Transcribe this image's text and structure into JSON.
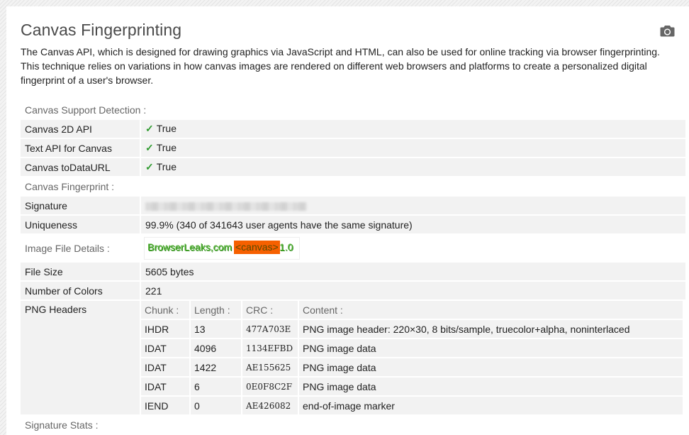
{
  "header": {
    "title": "Canvas Fingerprinting",
    "description": "The Canvas API, which is designed for drawing graphics via JavaScript and HTML, can also be used for online tracking via browser fingerprinting. This technique relies on variations in how canvas images are rendered on different web browsers and platforms to create a personalized digital fingerprint of a user's browser.",
    "camera_icon": "camera-icon"
  },
  "support": {
    "section_label": "Canvas Support Detection :",
    "rows": [
      {
        "label": "Canvas 2D API",
        "value": "True"
      },
      {
        "label": "Text API for Canvas",
        "value": "True"
      },
      {
        "label": "Canvas toDataURL",
        "value": "True"
      }
    ],
    "check_glyph": "✓"
  },
  "fingerprint": {
    "section_label": "Canvas Fingerprint :",
    "signature_label": "Signature",
    "uniqueness_label": "Uniqueness",
    "uniqueness_value": "99.9% (340 of 341643 user agents have the same signature)"
  },
  "image": {
    "section_label": "Image File Details :",
    "canvas_text_1": "BrowserLeaks,com",
    "canvas_badge": "<canvas>",
    "canvas_text_2": "1.0",
    "file_size_label": "File Size",
    "file_size_value": "5605 bytes",
    "colors_label": "Number of Colors",
    "colors_value": "221",
    "png_label": "PNG Headers",
    "png_columns": [
      "Chunk :",
      "Length :",
      "CRC :",
      "Content :"
    ],
    "png_rows": [
      {
        "chunk": "IHDR",
        "length": "13",
        "crc": "477A703E",
        "content": "PNG image header: 220×30, 8 bits/sample, truecolor+alpha, noninterlaced"
      },
      {
        "chunk": "IDAT",
        "length": "4096",
        "crc": "1134EFBD",
        "content": "PNG image data"
      },
      {
        "chunk": "IDAT",
        "length": "1422",
        "crc": "AE155625",
        "content": "PNG image data"
      },
      {
        "chunk": "IDAT",
        "length": "6",
        "crc": "0E0F8C2F",
        "content": "PNG image data"
      },
      {
        "chunk": "IEND",
        "length": "0",
        "crc": "AE426082",
        "content": "end-of-image marker"
      }
    ]
  },
  "stats": {
    "section_label": "Signature Stats :"
  }
}
